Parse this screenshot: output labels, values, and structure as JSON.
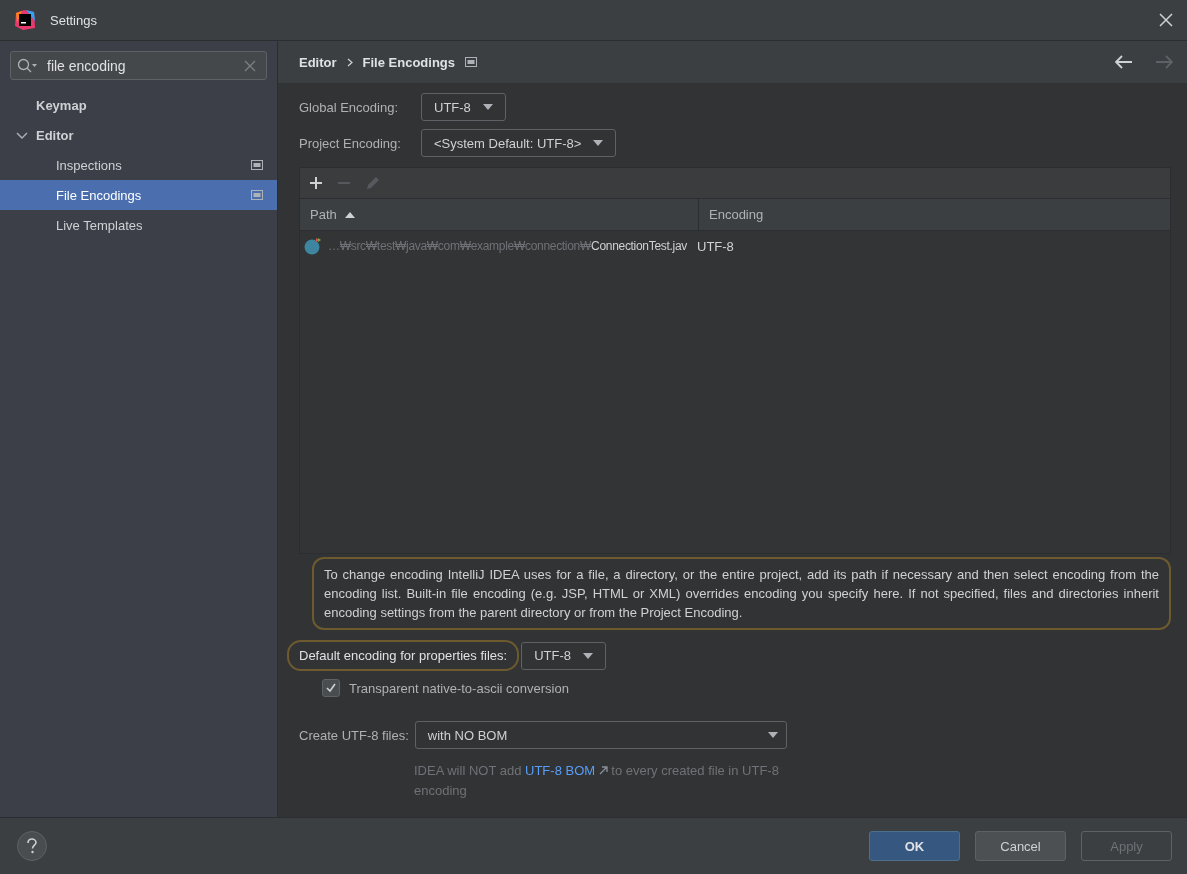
{
  "window": {
    "title": "Settings"
  },
  "search": {
    "value": "file encoding"
  },
  "sidebar": {
    "items": [
      {
        "label": "Keymap",
        "selected": false
      },
      {
        "label": "Editor",
        "selected": false,
        "expanded": true,
        "children": [
          {
            "label": "Inspections",
            "selected": false,
            "scope_icon": true
          },
          {
            "label": "File Encodings",
            "selected": true,
            "scope_icon": true
          },
          {
            "label": "Live Templates",
            "selected": false,
            "scope_icon": false
          }
        ]
      }
    ]
  },
  "breadcrumb": {
    "items": [
      "Editor",
      "File Encodings"
    ],
    "scope_icon": true,
    "back_disabled": false,
    "forward_disabled": true
  },
  "global_encoding": {
    "label": "Global Encoding:",
    "value": "UTF-8"
  },
  "project_encoding": {
    "label": "Project Encoding:",
    "value": "<System Default: UTF-8>"
  },
  "toolbar": [
    {
      "kind": "add",
      "disabled": false
    },
    {
      "kind": "remove",
      "disabled": true
    },
    {
      "kind": "edit",
      "disabled": true
    }
  ],
  "table": {
    "columns": [
      {
        "label": "Path",
        "sorted": true
      },
      {
        "label": "Encoding",
        "sorted": false
      }
    ],
    "rows": [
      {
        "path_dir": "…₩src₩test₩java₩com₩example₩connection₩",
        "path_file": "ConnectionTest.jav",
        "encoding": "UTF-8"
      }
    ]
  },
  "help_text": {
    "text": "To change encoding IntelliJ IDEA uses for a file, a directory, or the entire project, add its path if necessary and then select encoding from the encoding list. Built-in file encoding (e.g. JSP, HTML or XML) overrides encoding you specify here. If not specified, files and directories inherit encoding settings from the parent directory or from the Project Encoding.",
    "highlighted": true
  },
  "properties_encoding": {
    "label": "Default encoding for properties files:",
    "value": "UTF-8",
    "highlighted": true
  },
  "native_to_ascii": {
    "label": "Transparent native-to-ascii conversion",
    "checked": true
  },
  "create_utf8": {
    "label": "Create UTF-8 files:",
    "value": "with NO BOM"
  },
  "bom_note": {
    "before": "IDEA will NOT add",
    "link": "UTF-8 BOM",
    "after": "to every created file in UTF-8 encoding"
  },
  "buttons": [
    {
      "label": "OK",
      "kind": "default",
      "disabled": false
    },
    {
      "label": "Cancel",
      "kind": "normal",
      "disabled": false
    },
    {
      "label": "Apply",
      "kind": "normal",
      "disabled": true
    }
  ]
}
